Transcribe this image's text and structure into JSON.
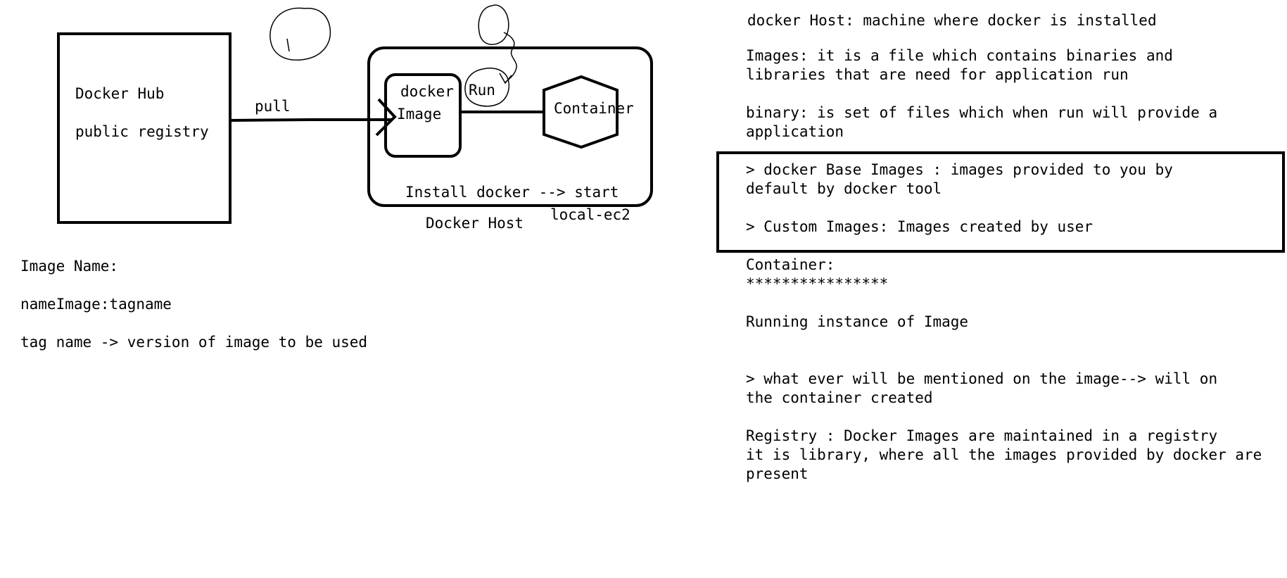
{
  "diagram": {
    "hub_title": "Docker Hub",
    "hub_subtitle": "public registry",
    "pull_label": "pull",
    "image_label_top": "docker",
    "image_label_bottom": "Image",
    "run_label": "Run",
    "container_label": "Container",
    "install_label": "Install docker --> start",
    "host_label": "Docker Host",
    "host_sublabel": "local-ec2"
  },
  "left_notes": {
    "image_name_heading": "Image Name:",
    "image_name_format": "nameImage:tagname",
    "tag_name_desc": "tag name -> version of image to be used"
  },
  "right_notes": {
    "docker_host_def": "docker Host: machine where docker is installed",
    "images_def_line1": "Images: it is a file which contains binaries and",
    "images_def_line2": "libraries that are need for application run",
    "binary_def_line1": "binary: is set of files which when run will provide a",
    "binary_def_line2": "application",
    "base_images_line1": "> docker Base Images : images provided to you by",
    "base_images_line2": "default by docker tool",
    "custom_images": "> Custom Images: Images created by user",
    "container_heading": "Container:",
    "container_stars": "****************",
    "container_def": "Running instance of Image",
    "mention_line1": "> what ever will be mentioned on the image--> will on",
    "mention_line2": "the container created",
    "registry_line1": "Registry : Docker Images are maintained in a registry",
    "registry_line2": "it is library, where all the images provided by docker are",
    "registry_line3": "present"
  }
}
